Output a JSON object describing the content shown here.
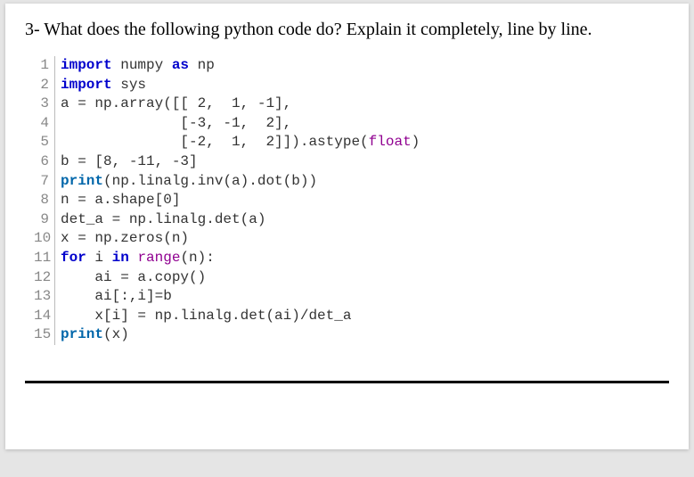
{
  "question": "3- What does the following python code do? Explain it completely, line by line.",
  "code": {
    "lines": [
      {
        "n": "1",
        "tokens": [
          {
            "t": "import",
            "c": "kw"
          },
          {
            "t": " numpy ",
            "c": ""
          },
          {
            "t": "as",
            "c": "kw"
          },
          {
            "t": " np",
            "c": ""
          }
        ]
      },
      {
        "n": "2",
        "tokens": [
          {
            "t": "import",
            "c": "kw"
          },
          {
            "t": " sys",
            "c": ""
          }
        ]
      },
      {
        "n": "3",
        "tokens": [
          {
            "t": "a = np.array([[ 2,  1, -1],",
            "c": ""
          }
        ]
      },
      {
        "n": "4",
        "tokens": [
          {
            "t": "              [-3, -1,  2],",
            "c": ""
          }
        ]
      },
      {
        "n": "5",
        "tokens": [
          {
            "t": "              [-2,  1,  2]]).astype(",
            "c": ""
          },
          {
            "t": "float",
            "c": "bi"
          },
          {
            "t": ")",
            "c": ""
          }
        ]
      },
      {
        "n": "6",
        "tokens": [
          {
            "t": "b = [8, -11, -3]",
            "c": ""
          }
        ]
      },
      {
        "n": "7",
        "tokens": [
          {
            "t": "print",
            "c": "kw2"
          },
          {
            "t": "(np.linalg.inv(a).dot(b))",
            "c": ""
          }
        ]
      },
      {
        "n": "8",
        "tokens": [
          {
            "t": "n = a.shape[0]",
            "c": ""
          }
        ]
      },
      {
        "n": "9",
        "tokens": [
          {
            "t": "det_a = np.linalg.det(a)",
            "c": ""
          }
        ]
      },
      {
        "n": "10",
        "tokens": [
          {
            "t": "x = np.zeros(n)",
            "c": ""
          }
        ]
      },
      {
        "n": "11",
        "tokens": [
          {
            "t": "for",
            "c": "kw"
          },
          {
            "t": " i ",
            "c": ""
          },
          {
            "t": "in",
            "c": "kw"
          },
          {
            "t": " ",
            "c": ""
          },
          {
            "t": "range",
            "c": "bi"
          },
          {
            "t": "(n):",
            "c": ""
          }
        ]
      },
      {
        "n": "12",
        "tokens": [
          {
            "t": "    ai = a.copy()",
            "c": ""
          }
        ]
      },
      {
        "n": "13",
        "tokens": [
          {
            "t": "    ai[:,i]=b",
            "c": ""
          }
        ]
      },
      {
        "n": "14",
        "tokens": [
          {
            "t": "    x[i] = np.linalg.det(ai)/det_a",
            "c": ""
          }
        ]
      },
      {
        "n": "15",
        "tokens": [
          {
            "t": "print",
            "c": "kw2"
          },
          {
            "t": "(x)",
            "c": ""
          }
        ]
      }
    ]
  }
}
